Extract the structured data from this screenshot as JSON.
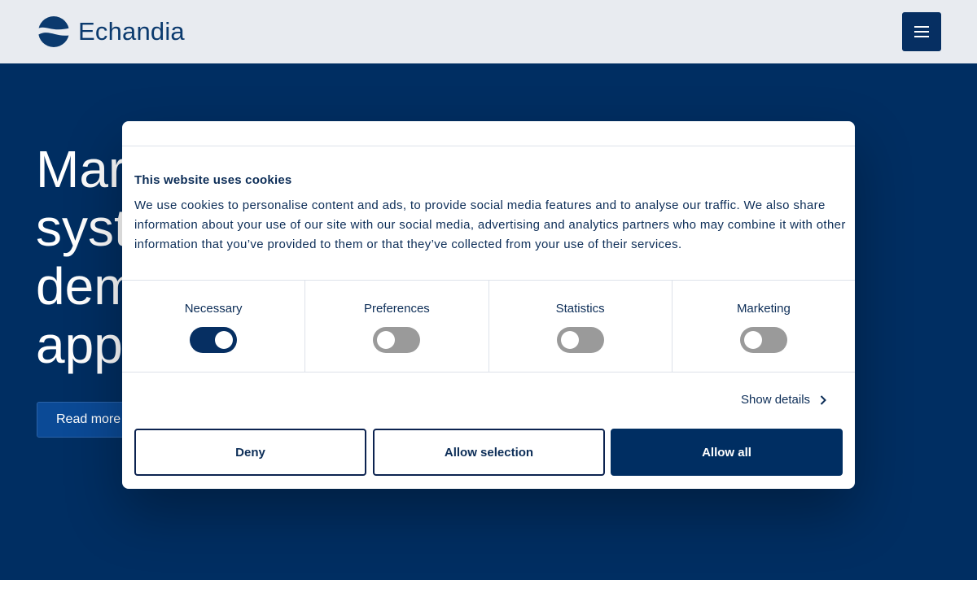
{
  "header": {
    "brand_name": "Echandia",
    "logo_icon": "echandia-logo-icon",
    "menu_icon": "hamburger-menu-icon"
  },
  "hero": {
    "headline_lines": [
      "Mar",
      "syst",
      "dem",
      "app"
    ],
    "read_more_label": "Read more"
  },
  "cookie_dialog": {
    "title": "This website uses cookies",
    "description": "We use cookies to personalise content and ads, to provide social media features and to analyse our traffic. We also share information about your use of our site with our social media, advertising and analytics partners who may combine it with other information that you’ve provided to them or that they’ve collected from your use of their services.",
    "categories": [
      {
        "label": "Necessary",
        "enabled": true
      },
      {
        "label": "Preferences",
        "enabled": false
      },
      {
        "label": "Statistics",
        "enabled": false
      },
      {
        "label": "Marketing",
        "enabled": false
      }
    ],
    "show_details_label": "Show details",
    "buttons": {
      "deny": "Deny",
      "allow_selection": "Allow selection",
      "allow_all": "Allow all"
    }
  },
  "colors": {
    "brand_navy": "#002e62",
    "header_bg": "#e8ebf0",
    "toggle_off": "#9a9a9a",
    "text_navy": "#0c2d57"
  }
}
